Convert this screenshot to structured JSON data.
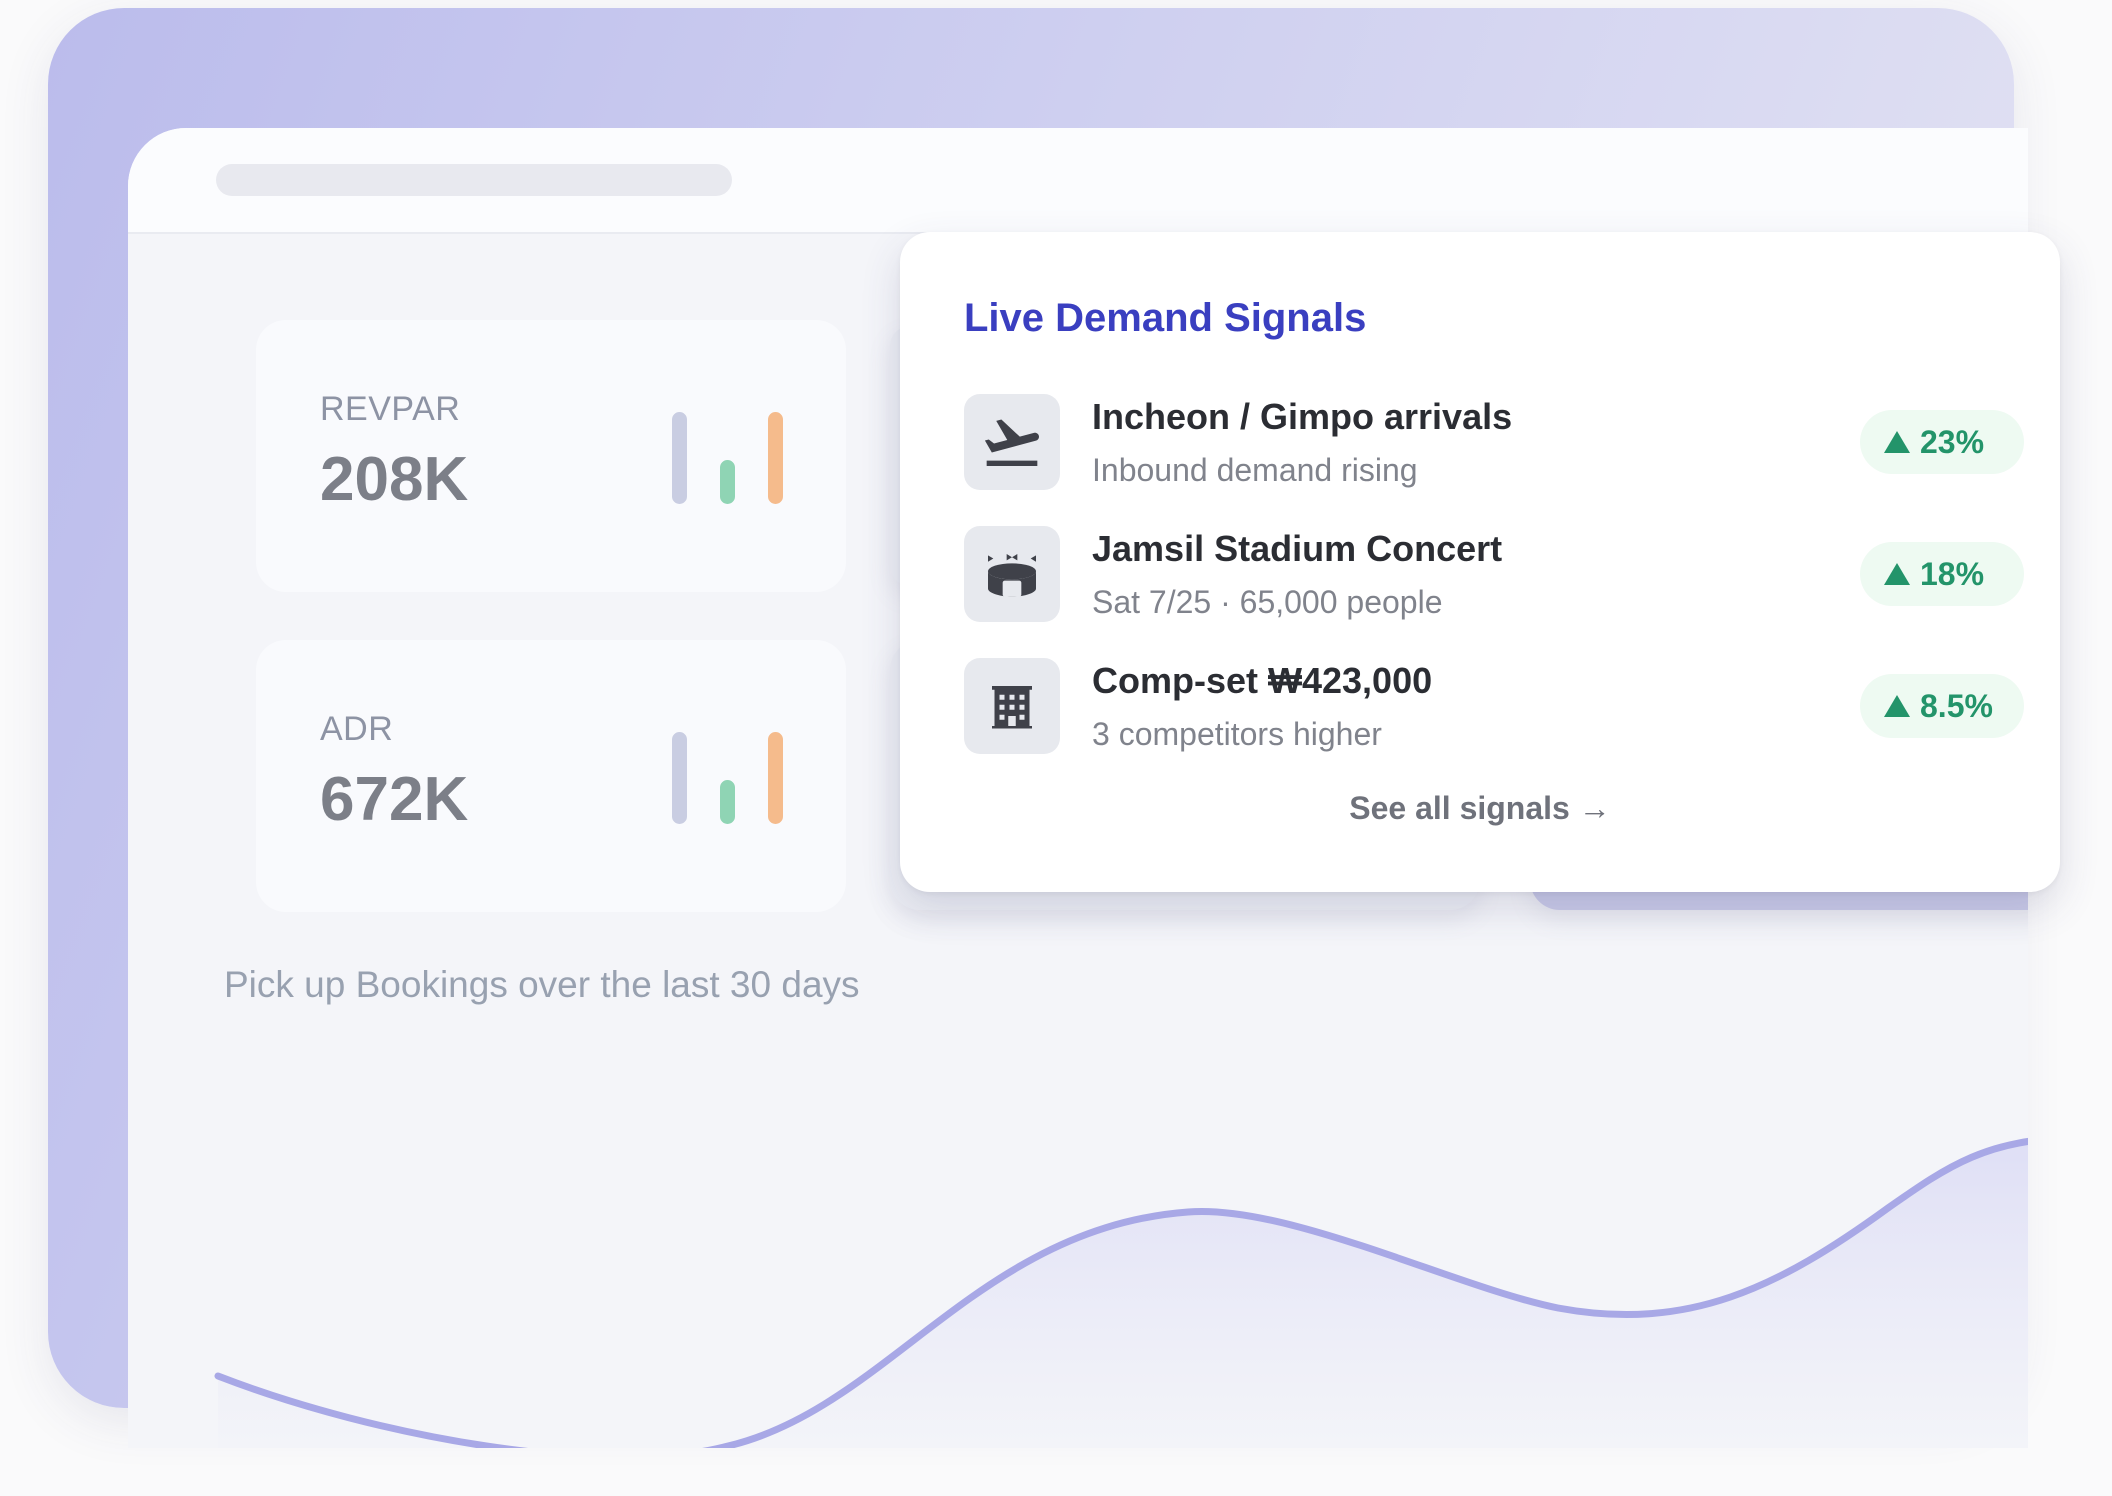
{
  "kpis": [
    {
      "label": "REVPAR",
      "value": "208K"
    },
    {
      "label": "ADR",
      "value": "672K"
    }
  ],
  "spark_colors": [
    "#c9cde2",
    "#8fd4b4",
    "#f5bb8c"
  ],
  "chart": {
    "title": "Pick up Bookings over the last 30 days",
    "line_color": "#a8a8e6"
  },
  "signals_card": {
    "title": "Live Demand Signals",
    "items": [
      {
        "icon": "airplane-departure-icon",
        "title": "Incheon / Gimpo arrivals",
        "subtitle": "Inbound demand rising",
        "change": "23%"
      },
      {
        "icon": "stadium-icon",
        "title": "Jamsil Stadium Concert",
        "subtitle": "Sat 7/25 · 65,000 people",
        "change": "18%"
      },
      {
        "icon": "hotel-building-icon",
        "title": "Comp-set ₩423,000",
        "subtitle": "3 competitors higher",
        "change": "8.5%"
      }
    ],
    "see_all": "See all signals →",
    "trend_color": "#23946a"
  }
}
